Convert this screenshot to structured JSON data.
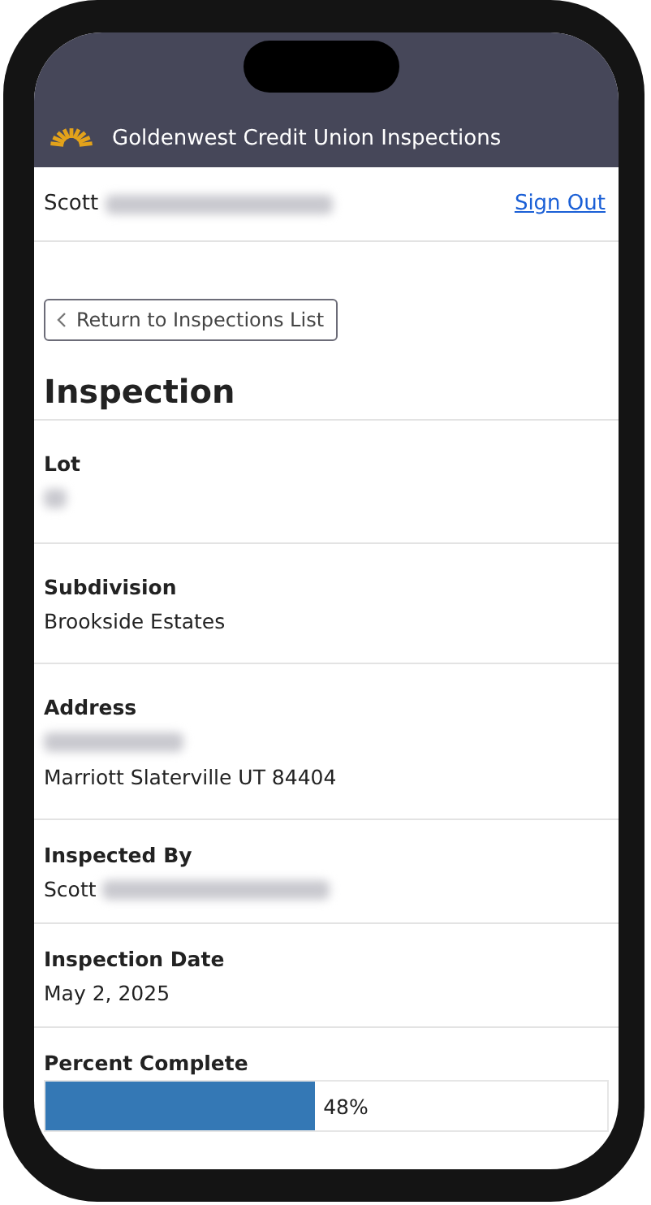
{
  "header": {
    "title": "Goldenwest Credit Union Inspections"
  },
  "user_bar": {
    "user": {
      "text": "Scott",
      "redacted": true
    },
    "sign_out": "Sign Out"
  },
  "back_button": "Return to Inspections List",
  "heading": "Inspection",
  "fields": [
    {
      "kind": "text",
      "label": "Lot",
      "lines": [
        {
          "redacted": true
        }
      ]
    },
    {
      "kind": "text",
      "label": "Subdivision",
      "lines": [
        {
          "text": "Brookside Estates",
          "redacted": false
        }
      ]
    },
    {
      "kind": "text",
      "label": "Address",
      "lines": [
        {
          "redacted": true
        },
        {
          "text": "Marriott Slaterville UT 84404",
          "redacted": false
        }
      ]
    },
    {
      "kind": "text",
      "label": "Inspected By",
      "lines": [
        {
          "text": "Scott",
          "redacted": true
        }
      ]
    },
    {
      "kind": "text",
      "label": "Inspection Date",
      "lines": [
        {
          "text": "May 2, 2025",
          "redacted": false
        }
      ]
    },
    {
      "kind": "progress",
      "label": "Percent Complete",
      "level": 0.48,
      "reading": "48%"
    }
  ]
}
